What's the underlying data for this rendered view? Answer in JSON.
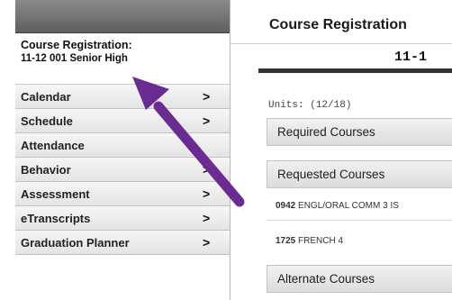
{
  "sidebar": {
    "header_title": "Course Registration:",
    "header_subtitle": "11-12 001 Senior High",
    "items": [
      {
        "label": "Calendar",
        "chevron": ">"
      },
      {
        "label": "Schedule",
        "chevron": ">"
      },
      {
        "label": "Attendance",
        "chevron": ""
      },
      {
        "label": "Behavior",
        "chevron": ">"
      },
      {
        "label": "Assessment",
        "chevron": ">"
      },
      {
        "label": "eTranscripts",
        "chevron": ">"
      },
      {
        "label": "Graduation Planner",
        "chevron": ">"
      }
    ]
  },
  "main": {
    "title": "Course Registration",
    "year_label": "11-1",
    "units": "Units: (12/18)",
    "sections": {
      "required": "Required Courses",
      "requested": "Requested Courses",
      "alternate": "Alternate Courses"
    },
    "courses": [
      {
        "code": "0942",
        "name": "ENGL/ORAL COMM 3 IS"
      },
      {
        "code": "1725",
        "name": "FRENCH 4"
      }
    ]
  },
  "colors": {
    "annotation_arrow": "#6a2c91",
    "sidebar_top_bar": "#6e6e6e"
  },
  "icons": {
    "nav_chevron": "chevron-right-icon",
    "annotation": "arrow-icon"
  }
}
